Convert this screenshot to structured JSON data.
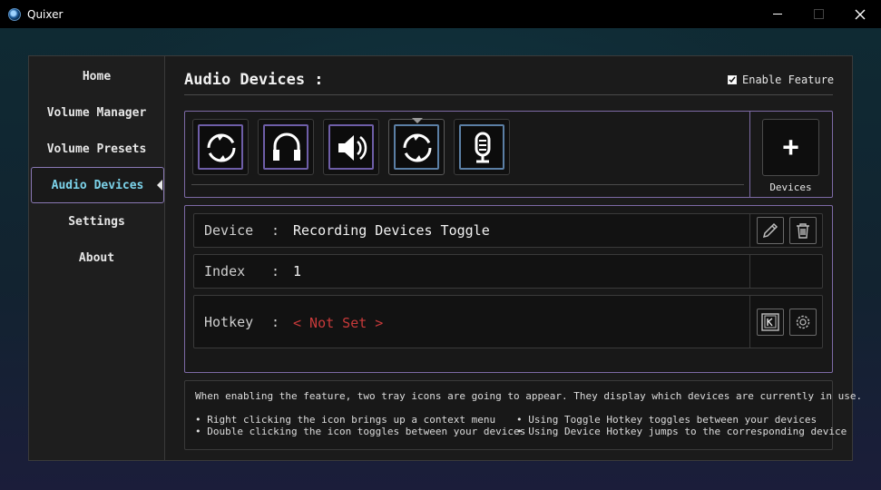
{
  "app": {
    "title": "Quixer"
  },
  "sidebar": {
    "items": [
      {
        "label": "Home"
      },
      {
        "label": "Volume Manager"
      },
      {
        "label": "Volume Presets"
      },
      {
        "label": "Audio Devices",
        "active": true
      },
      {
        "label": "Settings"
      },
      {
        "label": "About"
      }
    ]
  },
  "header": {
    "title": "Audio Devices :",
    "enable_feature_label": "Enable Feature",
    "enable_feature_checked": true
  },
  "devices": {
    "icons": [
      {
        "name": "playback-toggle-icon",
        "type": "playback"
      },
      {
        "name": "headphones-icon",
        "type": "playback"
      },
      {
        "name": "speaker-icon",
        "type": "playback"
      },
      {
        "name": "recording-toggle-icon",
        "type": "recording",
        "selected": true
      },
      {
        "name": "microphone-icon",
        "type": "recording"
      }
    ],
    "add_button_symbol": "+",
    "add_label": "Devices"
  },
  "details": {
    "device": {
      "label": "Device",
      "colon": ":",
      "value": "Recording Devices Toggle"
    },
    "index": {
      "label": "Index",
      "colon": ":",
      "value": "1"
    },
    "hotkey": {
      "label": "Hotkey",
      "colon": ":",
      "value": "< Not Set >"
    }
  },
  "info": {
    "intro": "When enabling the feature, two tray icons are going to appear. They display which devices are currently in use.",
    "bullets_left": [
      "• Right clicking the icon brings up a context menu",
      "• Double clicking the icon toggles between your devices"
    ],
    "bullets_right": [
      "• Using Toggle Hotkey toggles between your devices",
      "• Using Device Hotkey jumps to the corresponding device"
    ]
  },
  "colors": {
    "accent_purple": "#7d6aa5",
    "active_text": "#7cd3ea",
    "not_set_red": "#c83a3a"
  }
}
